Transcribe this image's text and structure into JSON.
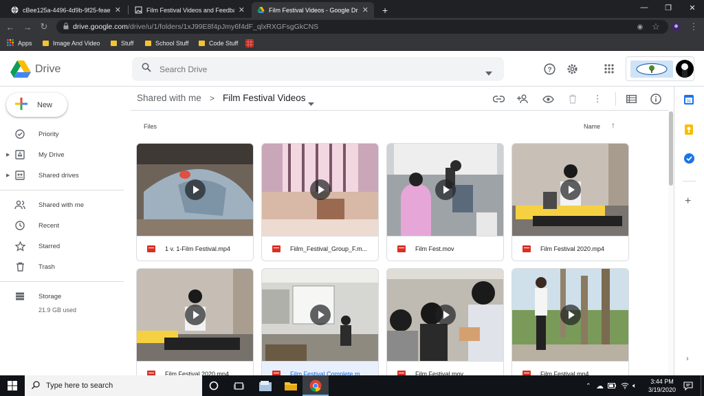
{
  "browser": {
    "tabs": [
      {
        "title": "cBee125a-4496-4d9b-9f25-feae7",
        "close": "✕"
      },
      {
        "title": "Film Festival Videos and Feedbac",
        "close": "✕"
      },
      {
        "title": "Film Festival Videos - Google Dri",
        "close": "✕"
      }
    ],
    "new_tab": "+",
    "url_host": "drive.google.com",
    "url_path": "/drive/u/1/folders/1xJ99E8f4pJmy6f4dF_qlxRXGFsgGkCNS",
    "bookmarks": [
      "Apps",
      "Image And Video",
      "Stuff",
      "School Stuff",
      "Code Stuff"
    ]
  },
  "drive": {
    "logo_text": "Drive",
    "search_placeholder": "Search Drive",
    "new_label": "New",
    "nav": {
      "priority": "Priority",
      "my_drive": "My Drive",
      "shared_drives": "Shared drives",
      "shared_with_me": "Shared with me",
      "recent": "Recent",
      "starred": "Starred",
      "trash": "Trash",
      "storage": "Storage",
      "storage_used": "21.9 GB used"
    },
    "breadcrumb": {
      "parent": "Shared with me",
      "separator": ">",
      "current": "Film Festival Videos"
    },
    "files_label": "Files",
    "sort_label": "Name",
    "sort_arrow": "↑",
    "files": [
      {
        "name": "1 v. 1-Film Festival.mp4"
      },
      {
        "name": "Fiilm_Festival_Group_F.m..."
      },
      {
        "name": "Film Fest.mov"
      },
      {
        "name": "Film Festival 2020.mp4"
      },
      {
        "name": "Film Festival 2020.mp4"
      },
      {
        "name": "Film Festival Complete.m..."
      },
      {
        "name": "Film Festival.mov"
      },
      {
        "name": "Film Festival.mp4"
      }
    ]
  },
  "taskbar": {
    "search_placeholder": "Type here to search",
    "time": "3:44 PM",
    "date": "3/19/2020"
  },
  "colors": {
    "accent_blue": "#1a73e8",
    "video_red": "#d93025",
    "selected_bg": "#e8f0fe"
  }
}
